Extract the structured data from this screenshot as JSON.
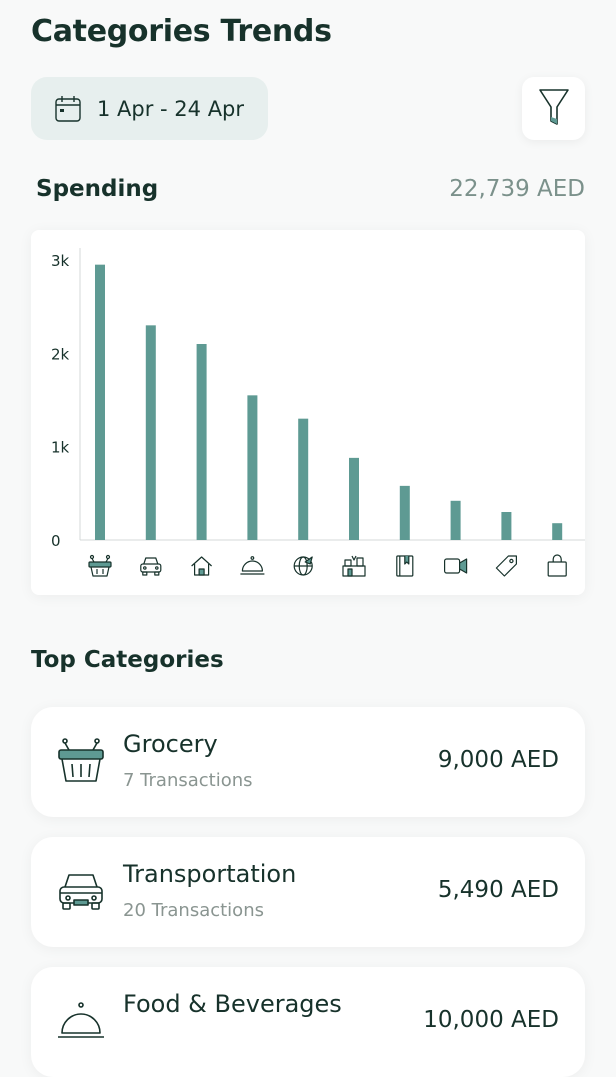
{
  "header": {
    "title": "Categories Trends"
  },
  "date_range": {
    "label": "1 Apr - 24 Apr",
    "icon": "calendar-icon"
  },
  "filter": {
    "icon": "funnel-filter-icon"
  },
  "spending": {
    "title": "Spending",
    "total": "22,739 AED"
  },
  "colors": {
    "accent": "#5e9a93",
    "dark_text": "#17322b",
    "muted": "#7b918b",
    "chip_bg": "#e7efee"
  },
  "chart_data": {
    "type": "bar",
    "categories": [
      "grocery-basket-icon",
      "car-icon",
      "home-icon",
      "food-cloche-icon",
      "globe-travel-icon",
      "gifts-icon",
      "book-icon",
      "video-camera-icon",
      "tag-icon",
      "shopping-bag-icon"
    ],
    "values": [
      2950,
      2300,
      2100,
      1550,
      1300,
      880,
      580,
      420,
      300,
      180
    ],
    "ytick_labels": [
      "0",
      "1k",
      "2k",
      "3k"
    ],
    "ylim": [
      0,
      3000
    ],
    "grid": false,
    "xlabel": "",
    "ylabel": "",
    "title": ""
  },
  "top_categories": {
    "title": "Top Categories",
    "items": [
      {
        "name": "Grocery",
        "transactions": "7 Transactions",
        "amount": "9,000 AED",
        "icon": "grocery-basket-icon"
      },
      {
        "name": "Transportation",
        "transactions": "20 Transactions",
        "amount": "5,490 AED",
        "icon": "car-icon"
      },
      {
        "name": "Food & Beverages",
        "transactions": "",
        "amount": "10,000 AED",
        "icon": "food-cloche-icon"
      }
    ]
  }
}
